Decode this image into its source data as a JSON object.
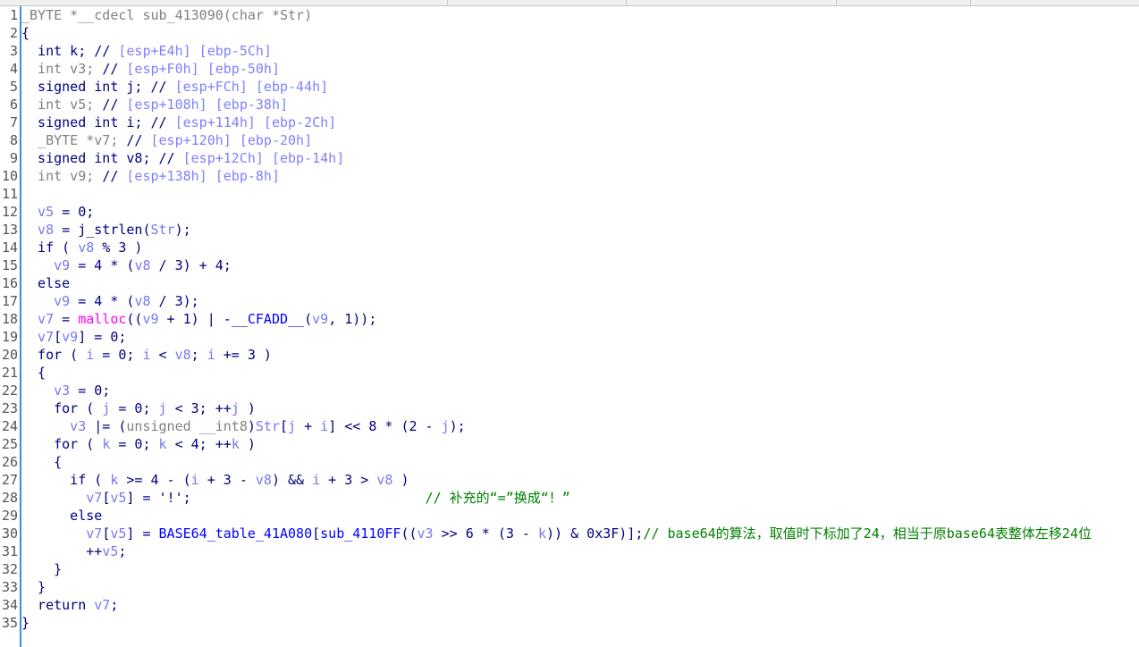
{
  "view": "pseudocode",
  "colors": {
    "keyword": "#000080",
    "variable": "#7878f0",
    "stack_comment": "#8080ff",
    "gray": "#808080",
    "import": "#ff00ff",
    "name": "#0000ff",
    "comment": "#008000",
    "gutter_line": "#3c8ce6"
  },
  "lines": [
    [
      [
        "g",
        "_BYTE *__cdecl sub_413090(char *Str)"
      ]
    ],
    [
      [
        "n",
        "{"
      ]
    ],
    [
      [
        "n",
        "  int k; // "
      ],
      [
        "c",
        "[esp+E4h] [ebp-5Ch]"
      ]
    ],
    [
      [
        "g",
        "  int v3; "
      ],
      [
        "n",
        "// "
      ],
      [
        "c",
        "[esp+F0h] [ebp-50h]"
      ]
    ],
    [
      [
        "n",
        "  signed int j; // "
      ],
      [
        "c",
        "[esp+FCh] [ebp-44h]"
      ]
    ],
    [
      [
        "g",
        "  int v5; "
      ],
      [
        "n",
        "// "
      ],
      [
        "c",
        "[esp+108h] [ebp-38h]"
      ]
    ],
    [
      [
        "n",
        "  signed int i; // "
      ],
      [
        "c",
        "[esp+114h] [ebp-2Ch]"
      ]
    ],
    [
      [
        "g",
        "  _BYTE *v7; "
      ],
      [
        "n",
        "// "
      ],
      [
        "c",
        "[esp+120h] [ebp-20h]"
      ]
    ],
    [
      [
        "n",
        "  signed int v8; // "
      ],
      [
        "c",
        "[esp+12Ch] [ebp-14h]"
      ]
    ],
    [
      [
        "g",
        "  int v9; "
      ],
      [
        "n",
        "// "
      ],
      [
        "c",
        "[esp+138h] [ebp-8h]"
      ]
    ],
    [],
    [
      [
        "v",
        "  v5"
      ],
      [
        "n",
        " = 0;"
      ]
    ],
    [
      [
        "v",
        "  v8"
      ],
      [
        "n",
        " = j_strlen("
      ],
      [
        "v",
        "Str"
      ],
      [
        "n",
        ");"
      ]
    ],
    [
      [
        "n",
        "  if ( "
      ],
      [
        "v",
        "v8"
      ],
      [
        "n",
        " % 3 )"
      ]
    ],
    [
      [
        "v",
        "    v9"
      ],
      [
        "n",
        " = 4 * ("
      ],
      [
        "v",
        "v8"
      ],
      [
        "n",
        " / 3) + 4;"
      ]
    ],
    [
      [
        "n",
        "  else"
      ]
    ],
    [
      [
        "v",
        "    v9"
      ],
      [
        "n",
        " = 4 * ("
      ],
      [
        "v",
        "v8"
      ],
      [
        "n",
        " / 3);"
      ]
    ],
    [
      [
        "v",
        "  v7"
      ],
      [
        "n",
        " = "
      ],
      [
        "m",
        "malloc"
      ],
      [
        "n",
        "(("
      ],
      [
        "v",
        "v9"
      ],
      [
        "n",
        " + 1) | -"
      ],
      [
        "b",
        "__CFADD__"
      ],
      [
        "n",
        "("
      ],
      [
        "v",
        "v9"
      ],
      [
        "n",
        ", 1));"
      ]
    ],
    [
      [
        "v",
        "  v7"
      ],
      [
        "n",
        "["
      ],
      [
        "v",
        "v9"
      ],
      [
        "n",
        "] = 0;"
      ]
    ],
    [
      [
        "n",
        "  for ( "
      ],
      [
        "v",
        "i"
      ],
      [
        "n",
        " = 0; "
      ],
      [
        "v",
        "i"
      ],
      [
        "n",
        " < "
      ],
      [
        "v",
        "v8"
      ],
      [
        "n",
        "; "
      ],
      [
        "v",
        "i"
      ],
      [
        "n",
        " += 3 )"
      ]
    ],
    [
      [
        "n",
        "  {"
      ]
    ],
    [
      [
        "v",
        "    v3"
      ],
      [
        "n",
        " = 0;"
      ]
    ],
    [
      [
        "n",
        "    for ( "
      ],
      [
        "v",
        "j"
      ],
      [
        "n",
        " = 0; "
      ],
      [
        "v",
        "j"
      ],
      [
        "n",
        " < 3; ++"
      ],
      [
        "v",
        "j"
      ],
      [
        "n",
        " )"
      ]
    ],
    [
      [
        "v",
        "      v3"
      ],
      [
        "n",
        " |= ("
      ],
      [
        "g",
        "unsigned __int8"
      ],
      [
        "n",
        ")"
      ],
      [
        "v",
        "Str"
      ],
      [
        "n",
        "["
      ],
      [
        "v",
        "j"
      ],
      [
        "n",
        " + "
      ],
      [
        "v",
        "i"
      ],
      [
        "n",
        "] << 8 * (2 - "
      ],
      [
        "v",
        "j"
      ],
      [
        "n",
        ");"
      ]
    ],
    [
      [
        "n",
        "    for ( "
      ],
      [
        "v",
        "k"
      ],
      [
        "n",
        " = 0; "
      ],
      [
        "v",
        "k"
      ],
      [
        "n",
        " < 4; ++"
      ],
      [
        "v",
        "k"
      ],
      [
        "n",
        " )"
      ]
    ],
    [
      [
        "n",
        "    {"
      ]
    ],
    [
      [
        "n",
        "      if ( "
      ],
      [
        "v",
        "k"
      ],
      [
        "n",
        " >= 4 - ("
      ],
      [
        "v",
        "i"
      ],
      [
        "n",
        " + 3 - "
      ],
      [
        "v",
        "v8"
      ],
      [
        "n",
        ") && "
      ],
      [
        "v",
        "i"
      ],
      [
        "n",
        " + 3 > "
      ],
      [
        "v",
        "v8"
      ],
      [
        "n",
        " )"
      ]
    ],
    [
      [
        "v",
        "        v7"
      ],
      [
        "n",
        "["
      ],
      [
        "v",
        "v5"
      ],
      [
        "n",
        "] = '!';                             "
      ],
      [
        "gr",
        "// 补充的“=”换成“！”"
      ]
    ],
    [
      [
        "n",
        "      else"
      ]
    ],
    [
      [
        "v",
        "        v7"
      ],
      [
        "n",
        "["
      ],
      [
        "v",
        "v5"
      ],
      [
        "n",
        "] = "
      ],
      [
        "b",
        "BASE64_table_41A080"
      ],
      [
        "n",
        "["
      ],
      [
        "b",
        "sub_4110FF"
      ],
      [
        "n",
        "(("
      ],
      [
        "v",
        "v3"
      ],
      [
        "n",
        " >> 6 * (3 - "
      ],
      [
        "v",
        "k"
      ],
      [
        "n",
        ")) & 0x3F)];"
      ],
      [
        "gr",
        "// base64的算法，取值时下标加了24，相当于原base64表整体左移24位"
      ]
    ],
    [
      [
        "n",
        "        ++"
      ],
      [
        "v",
        "v5"
      ],
      [
        "n",
        ";"
      ]
    ],
    [
      [
        "n",
        "    }"
      ]
    ],
    [
      [
        "n",
        "  }"
      ]
    ],
    [
      [
        "n",
        "  return "
      ],
      [
        "v",
        "v7"
      ],
      [
        "n",
        ";"
      ]
    ],
    [
      [
        "n",
        "}"
      ]
    ]
  ]
}
